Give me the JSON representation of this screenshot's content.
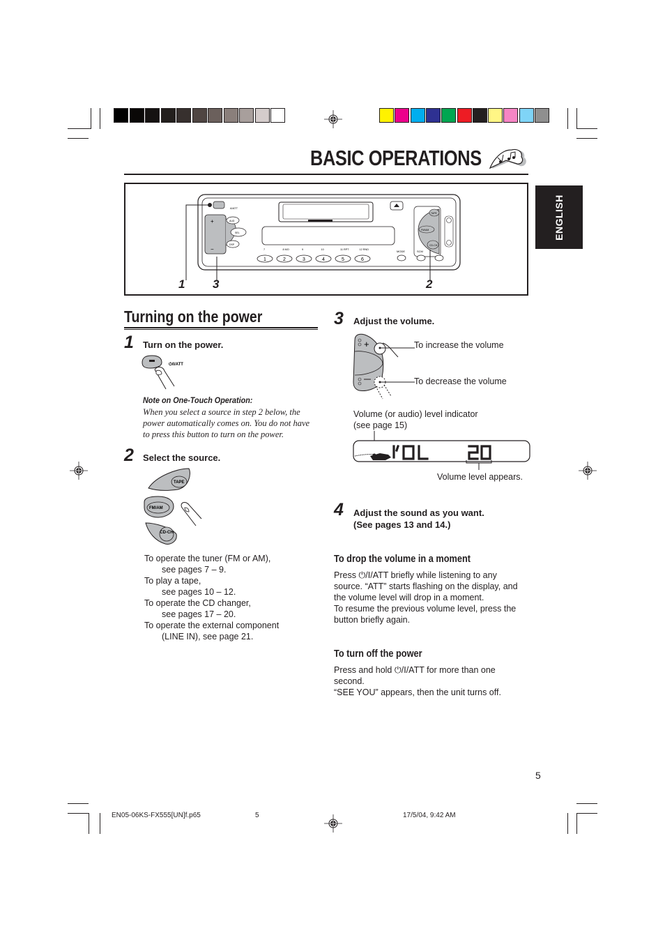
{
  "registration_bar": {
    "gray_swatches": [
      "#000000",
      "#0a0807",
      "#151211",
      "#231f1d",
      "#37302e",
      "#4f4542",
      "#6b605c",
      "#8a7f7b",
      "#a89f9c",
      "#d4cccb",
      "#ffffff"
    ],
    "color_swatches": [
      "#fff200",
      "#ec008c",
      "#00aeef",
      "#2e3192",
      "#00a651",
      "#ed1c24",
      "#231f20",
      "#fff685",
      "#f685c4",
      "#7fd4f7",
      "#8f8f8f"
    ]
  },
  "header": {
    "title": "BASIC OPERATIONS",
    "title_icon": "music-notes-icon",
    "language_tab": "ENGLISH"
  },
  "figure": {
    "callouts": [
      "1",
      "3",
      "2"
    ],
    "device_labels": {
      "att": "A/ATT",
      "aud": "AUD",
      "sel": "SEL",
      "dsp": "DSP",
      "tape": "TAPE",
      "fm_am": "FM/AM",
      "cd_ch": "CD-CH",
      "mode": "MODE",
      "scm": "SCM",
      "preset_functions": [
        "7",
        "8 MO",
        "9",
        "10",
        "11 RPT",
        "12 RND"
      ],
      "preset_numbers": [
        "1",
        "2",
        "3",
        "4",
        "5",
        "6"
      ]
    }
  },
  "section": {
    "heading": "Turning on the power",
    "steps": [
      {
        "number": "1",
        "label": "Turn on the power.",
        "button_label": "⏻/I/ATT",
        "note_heading": "Note on One-Touch Operation:",
        "note_lines": [
          "When you select a source in step 2 below, the",
          "power automatically comes on. You do not have",
          "to press this button to turn on the power."
        ]
      },
      {
        "number": "2",
        "label": "Select the source.",
        "buttons": [
          "TAPE",
          "FM/AM",
          "CD-CH"
        ],
        "instructions": [
          {
            "text": "To operate the tuner (FM or AM),",
            "indented": false
          },
          {
            "text": "see pages 7 – 9.",
            "indented": true
          },
          {
            "text": "To play a tape,",
            "indented": false
          },
          {
            "text": "see pages 10 – 12.",
            "indented": true
          },
          {
            "text": "To operate the CD changer,",
            "indented": false
          },
          {
            "text": "see pages 17 – 20.",
            "indented": true
          },
          {
            "text": "To operate the external component",
            "indented": false
          },
          {
            "text": "(LINE IN), see page 21.",
            "indented": true
          }
        ]
      },
      {
        "number": "3",
        "label": "Adjust the volume.",
        "increase_label": "To increase the volume",
        "decrease_label": "To decrease the volume",
        "indicator_label_lines": [
          "Volume (or audio) level indicator",
          "(see page 15)"
        ],
        "display_text": "VOL",
        "display_value": "20",
        "value_caption": "Volume level appears."
      },
      {
        "number": "4",
        "label_lines": [
          "Adjust the sound as you want.",
          "(See pages 13 and 14.)"
        ]
      }
    ]
  },
  "drop_volume": {
    "heading": "To drop the volume in a moment",
    "lines": [
      "Press ⏻/I/ATT briefly while listening to any",
      "source. “ATT” starts flashing on the display, and",
      "the volume level will drop in a moment.",
      "To resume the previous volume level, press the",
      "button briefly again."
    ]
  },
  "turn_off": {
    "heading": "To turn off the power",
    "lines": [
      "Press and hold ⏻/I/ATT for more than one",
      "second.",
      "“SEE YOU” appears, then the unit turns off."
    ]
  },
  "page_number": "5",
  "footer": {
    "filename": "EN05-06KS-FX555[UN]f.p65",
    "page": "5",
    "timestamp": "17/5/04, 9:42 AM"
  }
}
